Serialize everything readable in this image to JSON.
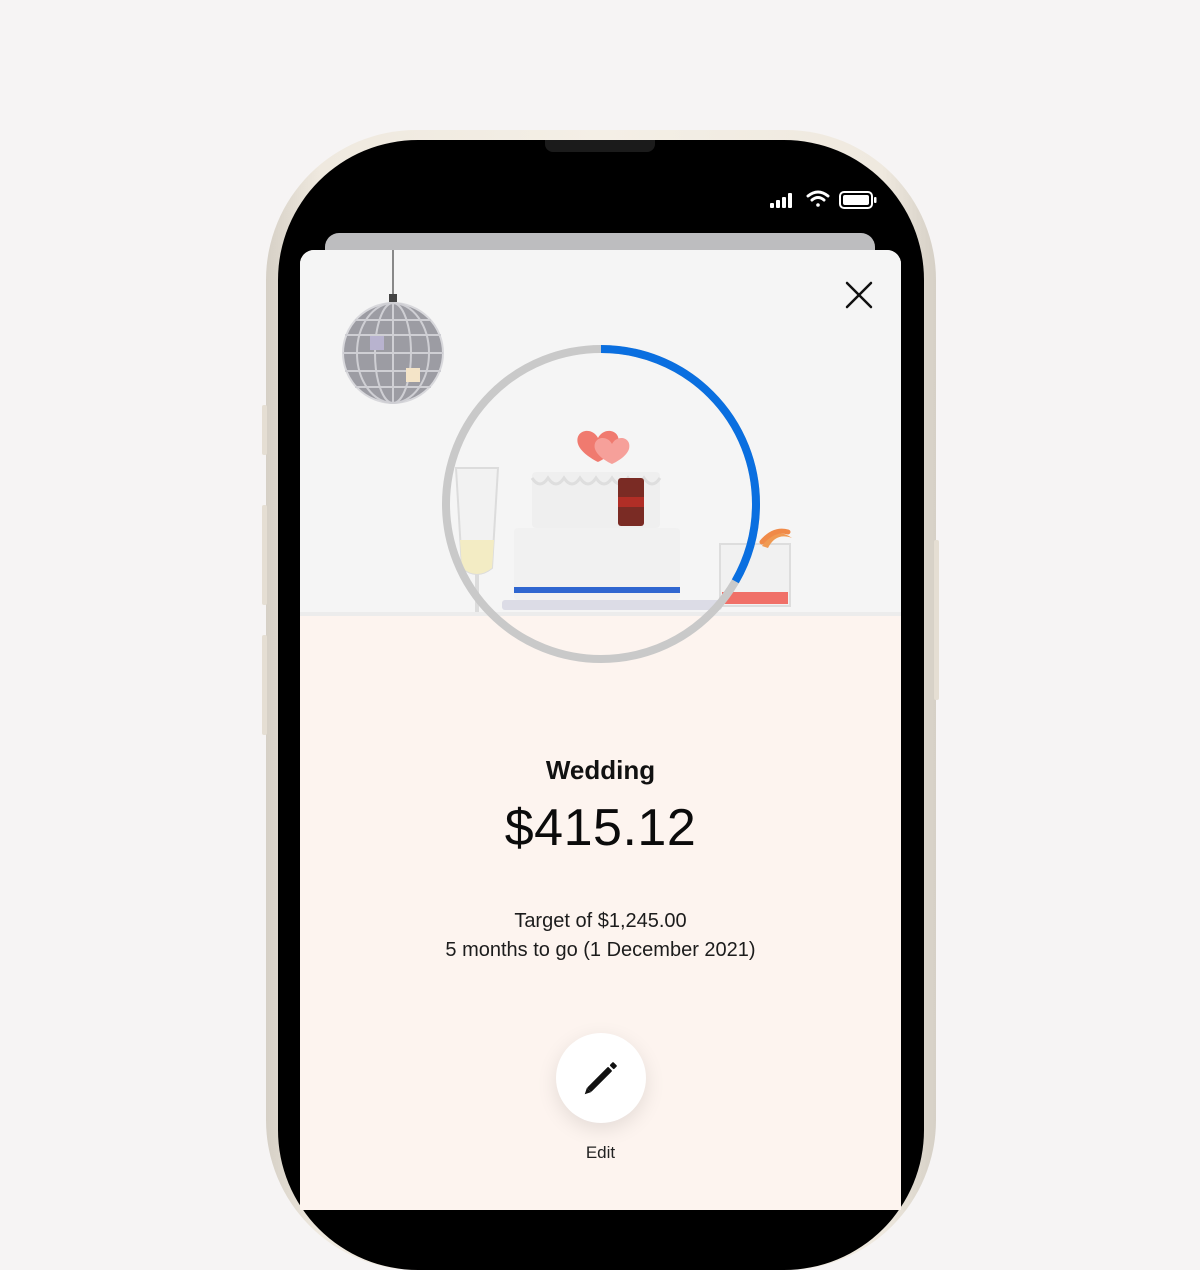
{
  "goal": {
    "name": "Wedding",
    "amount": "$415.12",
    "target_text": "Target of $1,245.00",
    "timeline_text": "5 months to go (1 December 2021)",
    "progress_fraction": 0.333
  },
  "actions": {
    "edit_label": "Edit"
  },
  "icons": {
    "close": "close-icon",
    "edit": "pencil-icon",
    "signal": "signal-icon",
    "wifi": "wifi-icon",
    "battery": "battery-icon"
  },
  "colors": {
    "progress": "#0a6fe0",
    "track": "#c9c9c9",
    "background": "#fdf4ef"
  }
}
